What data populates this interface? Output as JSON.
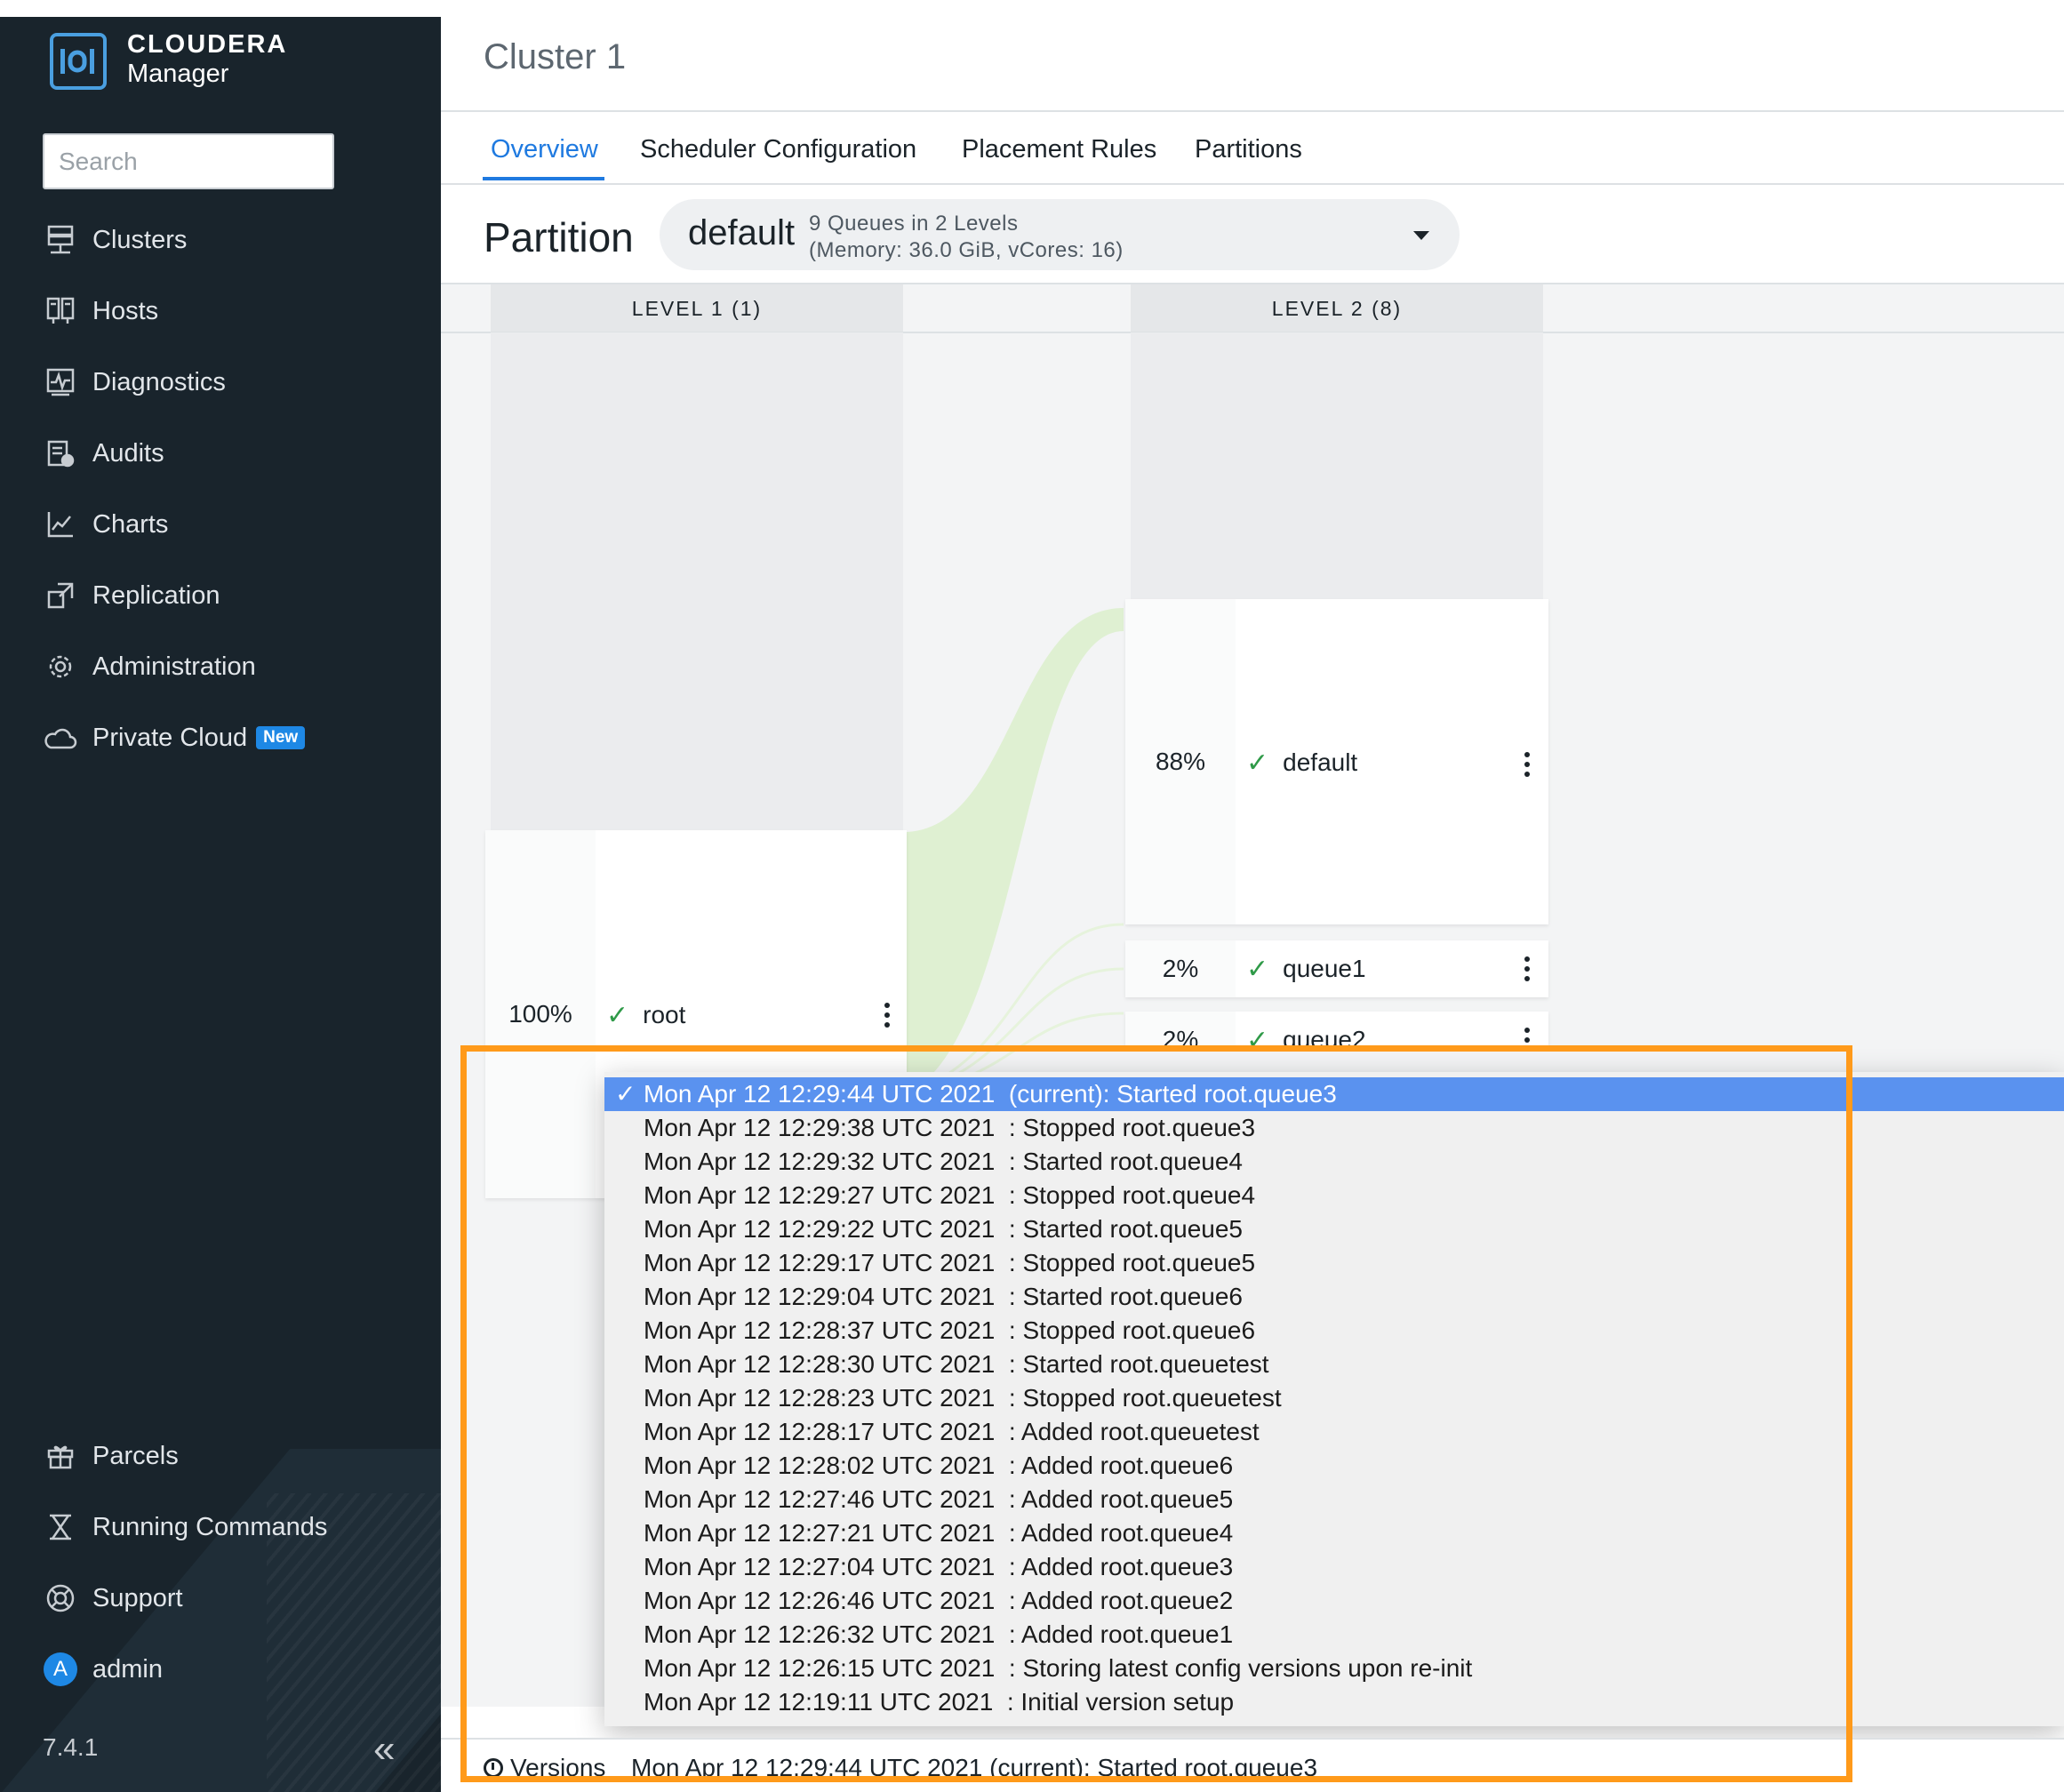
{
  "brand": {
    "line1": "CLOUDERA",
    "line2": "Manager"
  },
  "search": {
    "placeholder": "Search"
  },
  "nav": {
    "items": [
      {
        "label": "Clusters",
        "icon": "clusters-icon"
      },
      {
        "label": "Hosts",
        "icon": "hosts-icon"
      },
      {
        "label": "Diagnostics",
        "icon": "diagnostics-icon"
      },
      {
        "label": "Audits",
        "icon": "audits-icon"
      },
      {
        "label": "Charts",
        "icon": "charts-icon"
      },
      {
        "label": "Replication",
        "icon": "replication-icon"
      },
      {
        "label": "Administration",
        "icon": "gear-icon"
      },
      {
        "label": "Private Cloud",
        "icon": "cloud-icon",
        "badge": "New"
      }
    ],
    "bottom": [
      {
        "label": "Parcels",
        "icon": "gift-icon"
      },
      {
        "label": "Running Commands",
        "icon": "hourglass-icon"
      },
      {
        "label": "Support",
        "icon": "lifebuoy-icon"
      },
      {
        "label": "admin",
        "icon": "avatar",
        "initial": "A"
      }
    ],
    "version": "7.4.1",
    "collapse": "«"
  },
  "header": {
    "title": "Cluster 1"
  },
  "tabs": [
    {
      "label": "Overview",
      "active": true
    },
    {
      "label": "Scheduler Configuration"
    },
    {
      "label": "Placement Rules"
    },
    {
      "label": "Partitions"
    }
  ],
  "partition": {
    "label": "Partition",
    "selected": "default",
    "info1": "9 Queues in 2 Levels",
    "info2": "(Memory: 36.0 GiB, vCores: 16)"
  },
  "levels": [
    {
      "label": "LEVEL 1 (1)"
    },
    {
      "label": "LEVEL 2 (8)"
    }
  ],
  "queues": {
    "root": {
      "pct": "100%",
      "name": "root"
    },
    "default": {
      "pct": "88%",
      "name": "default"
    },
    "queue1": {
      "pct": "2%",
      "name": "queue1"
    },
    "queue2": {
      "pct": "2%",
      "name": "queue2"
    }
  },
  "versions": {
    "label": "Versions",
    "current": "Mon Apr 12 12:29:44 UTC 2021  (current): Started root.queue3",
    "options": [
      "Mon Apr 12 12:29:44 UTC 2021  (current): Started root.queue3",
      "Mon Apr 12 12:29:38 UTC 2021  : Stopped root.queue3",
      "Mon Apr 12 12:29:32 UTC 2021  : Started root.queue4",
      "Mon Apr 12 12:29:27 UTC 2021  : Stopped root.queue4",
      "Mon Apr 12 12:29:22 UTC 2021  : Started root.queue5",
      "Mon Apr 12 12:29:17 UTC 2021  : Stopped root.queue5",
      "Mon Apr 12 12:29:04 UTC 2021  : Started root.queue6",
      "Mon Apr 12 12:28:37 UTC 2021  : Stopped root.queue6",
      "Mon Apr 12 12:28:30 UTC 2021  : Started root.queuetest",
      "Mon Apr 12 12:28:23 UTC 2021  : Stopped root.queuetest",
      "Mon Apr 12 12:28:17 UTC 2021  : Added root.queuetest",
      "Mon Apr 12 12:28:02 UTC 2021  : Added root.queue6",
      "Mon Apr 12 12:27:46 UTC 2021  : Added root.queue5",
      "Mon Apr 12 12:27:21 UTC 2021  : Added root.queue4",
      "Mon Apr 12 12:27:04 UTC 2021  : Added root.queue3",
      "Mon Apr 12 12:26:46 UTC 2021  : Added root.queue2",
      "Mon Apr 12 12:26:32 UTC 2021  : Added root.queue1",
      "Mon Apr 12 12:26:15 UTC 2021  : Storing latest config versions upon re-init",
      "Mon Apr 12 12:19:11 UTC 2021  : Initial version setup"
    ],
    "selected_index": 0
  },
  "colors": {
    "sidebar": "#19242c",
    "accent": "#1f7ae0",
    "highlight": "#ff9a1a",
    "selected": "#5a92ef",
    "ok": "#2f9a48"
  }
}
